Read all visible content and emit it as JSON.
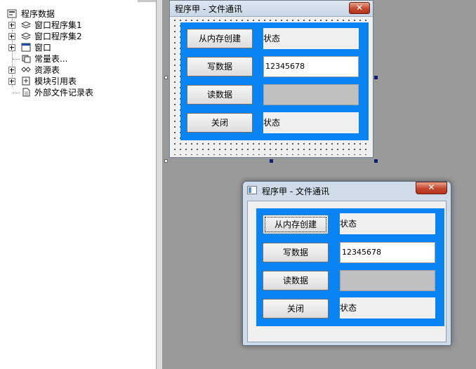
{
  "tree": {
    "root": {
      "label": "程序数据",
      "icon": "program-data-icon"
    },
    "items": [
      {
        "label": "窗口程序集1",
        "icon": "assembly-icon",
        "expandable": true
      },
      {
        "label": "窗口程序集2",
        "icon": "assembly-icon",
        "expandable": true
      },
      {
        "label": "窗口",
        "icon": "window-icon",
        "expandable": true
      },
      {
        "label": "常量表...",
        "icon": "constants-icon",
        "expandable": false
      },
      {
        "label": "资源表",
        "icon": "resources-icon",
        "expandable": true
      },
      {
        "label": "模块引用表",
        "icon": "module-ref-icon",
        "expandable": true
      },
      {
        "label": "外部文件记录表",
        "icon": "external-file-icon",
        "expandable": false
      }
    ]
  },
  "design_form": {
    "title": "程序甲 - 文件通讯",
    "close_glyph": "✕",
    "buttons": [
      "从内存创建",
      "写数据",
      "读数据",
      "关闭"
    ],
    "status_label_1": "状态",
    "edit_value": "12345678",
    "status_label_2": "状态"
  },
  "run_window": {
    "title": "程序甲 - 文件通讯",
    "close_glyph": "✕",
    "buttons": [
      "从内存创建",
      "写数据",
      "读数据",
      "关闭"
    ],
    "status_label_1": "状态",
    "edit_value": "12345678",
    "status_label_2": "状态"
  },
  "colors": {
    "panel_blue": "#0a84f2",
    "workspace": "#9a9a9a"
  }
}
